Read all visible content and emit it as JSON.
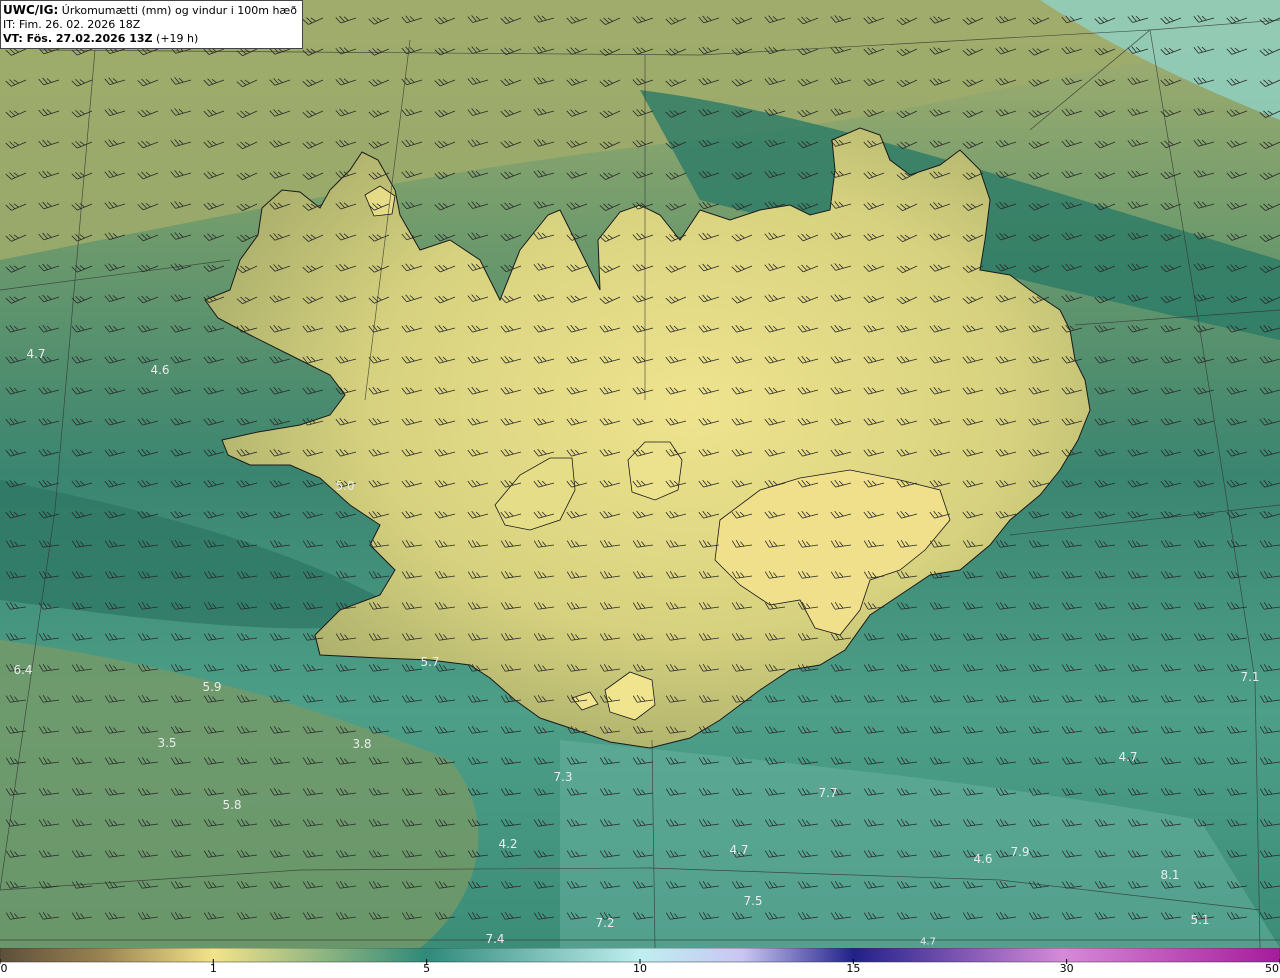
{
  "title": {
    "model": "UWC/IG:",
    "field": "Úrkomumætti (mm) og vindur i 100m hæð",
    "it_line": "IT: Fim. 26. 02. 2026 18Z",
    "vt_prefix": "VT: Fös. 27.02.2026 13Z",
    "vt_suffix": "(+19 h)"
  },
  "colorbar": {
    "ticks": [
      {
        "label": "0",
        "pos": 0
      },
      {
        "label": "1",
        "pos": 1
      },
      {
        "label": "5",
        "pos": 2
      },
      {
        "label": "10",
        "pos": 3
      },
      {
        "label": "15",
        "pos": 4
      },
      {
        "label": "30",
        "pos": 5
      },
      {
        "label": "50",
        "pos": 6
      }
    ],
    "stops": [
      "#5c4f3a",
      "#b89a5e",
      "#f3e38a",
      "#2f8a7a",
      "#bfeff0",
      "#c9c6f2",
      "#21208a",
      "#d58ad8",
      "#a51b9a"
    ]
  },
  "colors": {
    "sea_dark": "#1f6e5c",
    "sea_mid": "#3d8a72",
    "land_yellow": "#e6dc86",
    "land_olive": "#a8ad6a",
    "coast": "#1a1a1a"
  },
  "values": [
    {
      "text": "4.7"
    },
    {
      "text": "4.6"
    },
    {
      "text": "5.0"
    },
    {
      "text": "5.7"
    },
    {
      "text": "6.4"
    },
    {
      "text": "5.9"
    },
    {
      "text": "3.5"
    },
    {
      "text": "3.8"
    },
    {
      "text": "5.8"
    },
    {
      "text": "7.3"
    },
    {
      "text": "4.2"
    },
    {
      "text": "7.7"
    },
    {
      "text": "4.7"
    },
    {
      "text": "7.5"
    },
    {
      "text": "7.2"
    },
    {
      "text": "7.4"
    },
    {
      "text": "4.7"
    },
    {
      "text": "4.6"
    },
    {
      "text": "7.9"
    },
    {
      "text": "8.1"
    },
    {
      "text": "5.1"
    },
    {
      "text": "7.1"
    },
    {
      "text": "4.7"
    }
  ]
}
